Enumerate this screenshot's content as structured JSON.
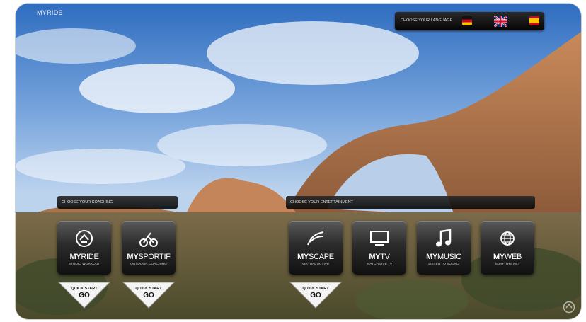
{
  "brand": {
    "label": "MYRIDE"
  },
  "language": {
    "label": "CHOOSE YOUR LANGUAGE",
    "flags": [
      {
        "name": "German",
        "icon": "flag-germany-icon"
      },
      {
        "name": "English",
        "icon": "flag-uk-icon"
      },
      {
        "name": "Spanish",
        "icon": "flag-spain-icon"
      }
    ]
  },
  "coaching": {
    "label": "CHOOSE YOUR COACHING",
    "tiles": [
      {
        "prefix": "MY",
        "suffix": "RIDE",
        "sub": "STUDIO WORKOUT",
        "icon": "rider-icon"
      },
      {
        "prefix": "MY",
        "suffix": "SPORTIF",
        "sub": "OUTDOOR COACHING",
        "icon": "cyclist-icon"
      }
    ]
  },
  "entertainment": {
    "label": "CHOOSE YOUR ENTERTAINMENT",
    "tiles": [
      {
        "prefix": "MY",
        "suffix": "SCAPE",
        "sub": "VIRTUAL ACTIVE",
        "icon": "landscape-icon"
      },
      {
        "prefix": "MY",
        "suffix": "TV",
        "sub": "WATCH LIVE TV",
        "icon": "tv-icon"
      },
      {
        "prefix": "MY",
        "suffix": "MUSIC",
        "sub": "LISTEN TO SOUND",
        "icon": "music-note-icon"
      },
      {
        "prefix": "MY",
        "suffix": "WEB",
        "sub": "SURF THE NET",
        "icon": "globe-icon"
      }
    ]
  },
  "quick_start": {
    "line1": "QUICK START",
    "line2": "GO"
  }
}
